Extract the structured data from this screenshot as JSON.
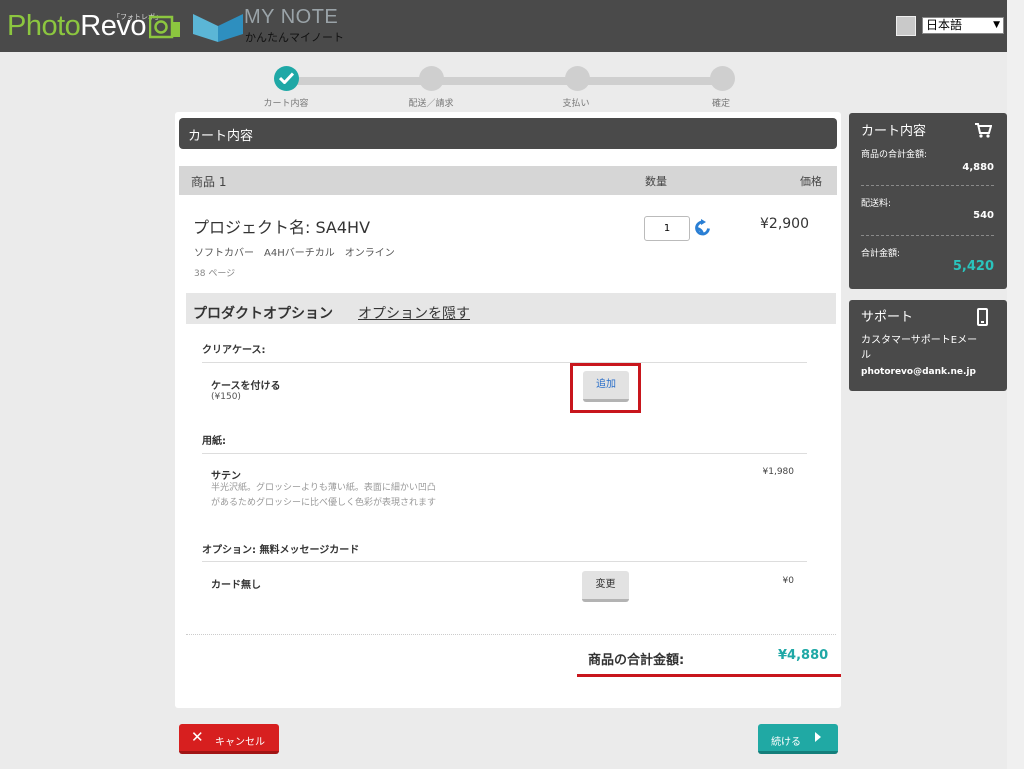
{
  "header": {
    "logo_part1": "Photo",
    "logo_part2": "Revo",
    "logo_tag": "「フォトレボ」",
    "mynote_title": "MY NOTE",
    "mynote_sub": "かんたんマイノート",
    "language": "日本語"
  },
  "steps": [
    {
      "label": "カート内容",
      "state": "done"
    },
    {
      "label": "配送／請求",
      "state": "todo"
    },
    {
      "label": "支払い",
      "state": "todo"
    },
    {
      "label": "確定",
      "state": "todo"
    }
  ],
  "main": {
    "title": "カート内容",
    "col_item": "商品 1",
    "col_qty": "数量",
    "col_price": "価格",
    "project_name": "プロジェクト名: SA4HV",
    "project_spec": "ソフトカバー　A4Hバーチカル　オンライン",
    "project_pages": "38 ページ",
    "quantity": "1",
    "price": "¥2,900"
  },
  "options": {
    "title": "プロダクトオプション",
    "hide_link": "オプションを隠す",
    "clear_case": {
      "section": "クリアケース:",
      "name": "ケースを付ける",
      "sub": "(¥150)",
      "button": "追加"
    },
    "paper": {
      "section": "用紙:",
      "name": "サテン",
      "desc1": "半光沢紙。グロッシーよりも薄い紙。表面に細かい凹凸",
      "desc2": "があるためグロッシーに比べ優しく色彩が表現されます",
      "price": "¥1,980"
    },
    "message": {
      "section": "オプション: 無料メッセージカード",
      "name": "カード無し",
      "button": "変更",
      "price": "¥0"
    }
  },
  "footer": {
    "total_label": "商品の合計金額:",
    "total_value": "¥4,880",
    "cancel": "キャンセル",
    "next": "続ける"
  },
  "sidebar": {
    "cart_title": "カート内容",
    "subtotal_label": "商品の合計金額:",
    "subtotal_value": "4,880",
    "shipping_label": "配送料:",
    "shipping_value": "540",
    "total_label": "合計金額:",
    "total_value": "5,420",
    "support_title": "サポート",
    "support_text": "カスタマーサポートEメール",
    "support_email": "photorevo@dank.ne.jp"
  },
  "colors": {
    "accent_teal": "#1fa8a6",
    "header_dark": "#4a4a4a",
    "highlight_red": "#c8161d",
    "cancel_red": "#d71f1f"
  }
}
